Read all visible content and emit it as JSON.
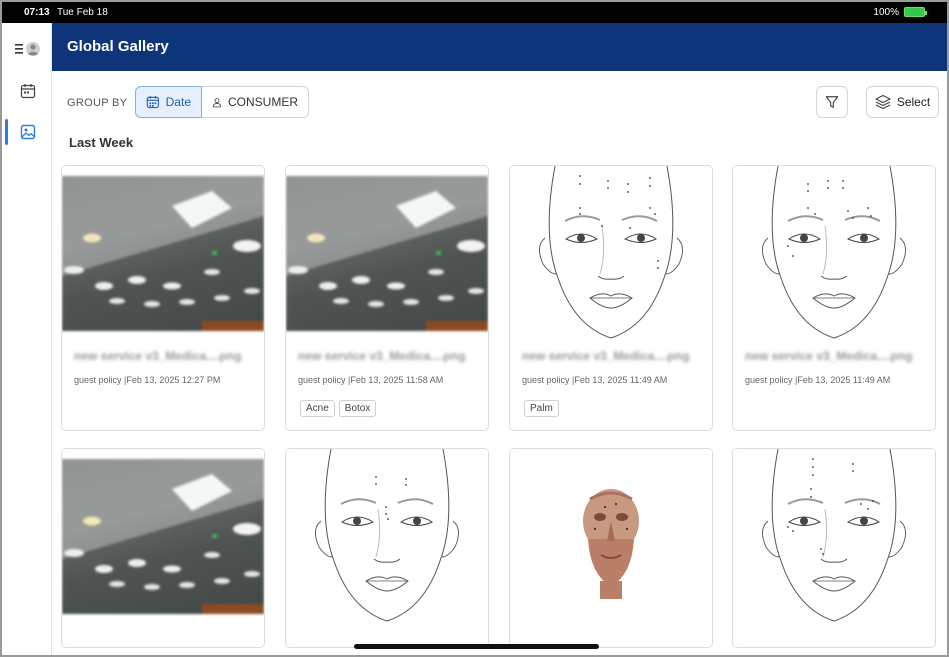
{
  "status_bar": {
    "time": "07:13",
    "date": "Tue Feb 18",
    "battery": "100%"
  },
  "header": {
    "title": "Global Gallery"
  },
  "toolbar": {
    "group_by_label": "GROUP BY",
    "date_label": "Date",
    "consumer_label": "CONSUMER",
    "select_label": "Select"
  },
  "section": {
    "title": "Last Week"
  },
  "cards": [
    {
      "type": "photo",
      "filename": "new service v3_Medica....png",
      "meta": "guest policy  |Feb 13, 2025 12:27 PM",
      "tags": []
    },
    {
      "type": "photo",
      "filename": "new service v3_Medica....png",
      "meta": "guest policy  |Feb 13, 2025 11:58 AM",
      "tags": [
        "Acne",
        "Botox"
      ]
    },
    {
      "type": "face",
      "filename": "new service v3_Medica....png",
      "meta": "guest policy  |Feb 13, 2025 11:49 AM",
      "tags": [
        "Palm"
      ]
    },
    {
      "type": "face",
      "filename": "new service v3_Medica....png",
      "meta": "guest policy  |Feb 13, 2025 11:49 AM",
      "tags": []
    },
    {
      "type": "photo",
      "filename": "",
      "meta": "",
      "tags": []
    },
    {
      "type": "face",
      "filename": "",
      "meta": "",
      "tags": []
    },
    {
      "type": "anatomy",
      "filename": "",
      "meta": "",
      "tags": []
    },
    {
      "type": "face",
      "filename": "",
      "meta": "",
      "tags": []
    }
  ],
  "icons": {
    "menu": "hamburger-icon",
    "avatar": "avatar-icon",
    "calendar": "calendar-icon",
    "gallery": "gallery-icon",
    "filter": "filter-icon",
    "layers": "layers-icon",
    "person": "person-icon"
  },
  "colors": {
    "header": "#0e347a",
    "accent": "#2f7cd8",
    "active_segment_bg": "#e5f0fc"
  }
}
